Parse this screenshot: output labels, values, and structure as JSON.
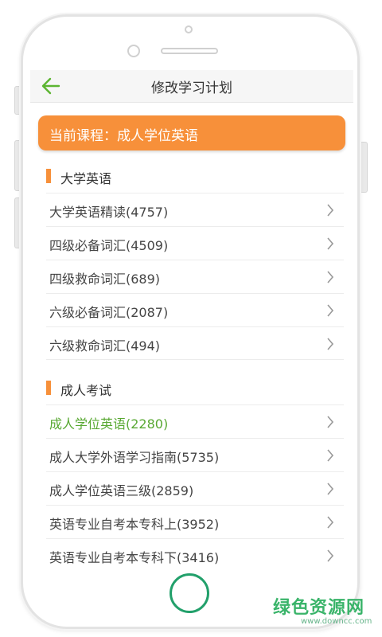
{
  "header": {
    "title": "修改学习计划",
    "back_icon": "back-arrow-icon"
  },
  "course_banner": {
    "label": "当前课程：成人学位英语"
  },
  "sections": [
    {
      "title": "大学英语",
      "items": [
        {
          "label": "大学英语精读(4757)"
        },
        {
          "label": "四级必备词汇(4509)"
        },
        {
          "label": "四级救命词汇(689)"
        },
        {
          "label": "六级必备词汇(2087)"
        },
        {
          "label": "六级救命词汇(494)"
        }
      ]
    },
    {
      "title": "成人考试",
      "items": [
        {
          "label": "成人学位英语(2280)",
          "selected": true
        },
        {
          "label": "成人大学外语学习指南(5735)"
        },
        {
          "label": "成人学位英语三级(2859)"
        },
        {
          "label": "英语专业自考本专科上(3952)"
        },
        {
          "label": "英语专业自考本专科下(3416)"
        }
      ]
    }
  ],
  "watermark": {
    "text": "绿色资源网",
    "url": "www.downcc.com"
  },
  "colors": {
    "accent": "#f7903a",
    "selected_text": "#58a832",
    "home_button": "#22a06b",
    "back_arrow": "#5cb531"
  }
}
